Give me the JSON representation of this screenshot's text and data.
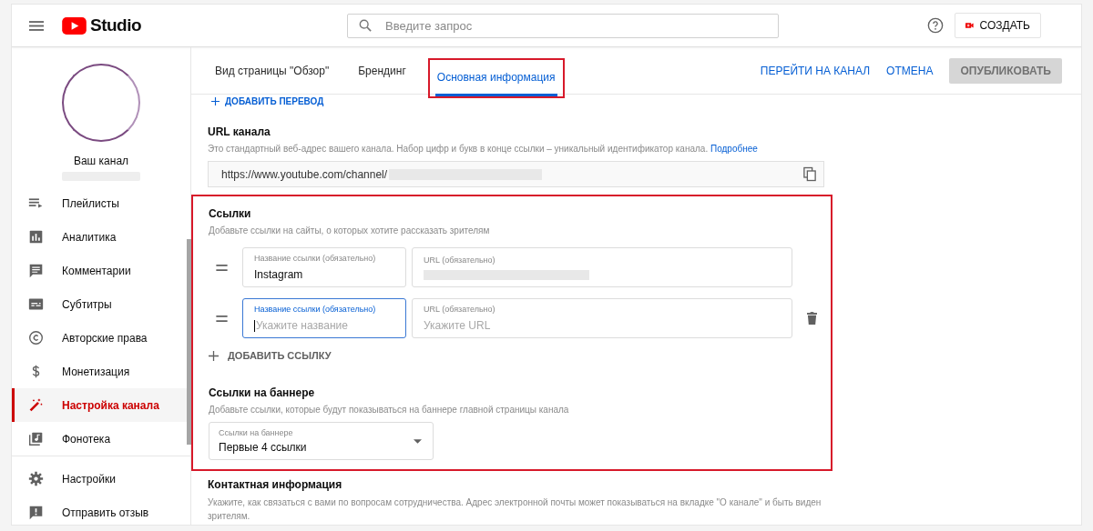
{
  "header": {
    "logo_text": "Studio",
    "search": {
      "placeholder": "Введите запрос"
    },
    "create_button": "СОЗДАТЬ"
  },
  "sidebar": {
    "channel_name": "Ваш канал",
    "items": [
      {
        "label": "Плейлисты",
        "selected": false
      },
      {
        "label": "Аналитика",
        "selected": false
      },
      {
        "label": "Комментарии",
        "selected": false
      },
      {
        "label": "Субтитры",
        "selected": false
      },
      {
        "label": "Авторские права",
        "selected": false
      },
      {
        "label": "Монетизация",
        "selected": false
      },
      {
        "label": "Настройка канала",
        "selected": true
      },
      {
        "label": "Фонотека",
        "selected": false
      }
    ],
    "footer_items": [
      {
        "label": "Настройки",
        "selected": false
      },
      {
        "label": "Отправить отзыв",
        "selected": false
      }
    ]
  },
  "tabs": [
    {
      "label": "Вид страницы \"Обзор\"",
      "selected": false,
      "annotated": false
    },
    {
      "label": "Брендинг",
      "selected": false,
      "annotated": false
    },
    {
      "label": "Основная информация",
      "selected": true,
      "annotated": true
    }
  ],
  "actions": {
    "view_channel": "ПЕРЕЙТИ НА КАНАЛ",
    "cancel": "ОТМЕНА",
    "publish": {
      "label": "ОПУБЛИКОВАТЬ",
      "disabled": true
    }
  },
  "add_translation": "ДОБАВИТЬ ПЕРЕВОД",
  "url_section": {
    "title": "URL канала",
    "description": "Это стандартный веб-адрес вашего канала. Набор цифр и букв в конце ссылки – уникальный идентификатор канала.",
    "link": "Подробнее",
    "value": "https://www.youtube.com/channel/"
  },
  "links_section": {
    "annotated": true,
    "title": "Ссылки",
    "description": "Добавьте ссылки на сайты, о которых хотите рассказать зрителям",
    "rows": [
      {
        "name_label": "Название ссылки (обязательно)",
        "name_value": "Instagram",
        "url_label": "URL (обязательно)",
        "url_redacted": true,
        "focused": false,
        "show_delete": false
      },
      {
        "name_label": "Название ссылки (обязательно)",
        "name_placeholder": "Укажите название",
        "url_label": "URL (обязательно)",
        "url_placeholder": "Укажите URL",
        "url_redacted": false,
        "focused": true,
        "show_delete": true
      }
    ],
    "add_link": "ДОБАВИТЬ ССЫЛКУ",
    "banner": {
      "title": "Ссылки на баннере",
      "description": "Добавьте ссылки, которые будут показываться на баннере главной страницы канала",
      "select_label": "Ссылки на баннере",
      "select_value": "Первые 4 ссылки"
    }
  },
  "contact_section": {
    "title": "Контактная информация",
    "description": "Укажите, как связаться с вами по вопросам сотрудничества. Адрес электронной почты может показываться на вкладке \"О канале\" и быть виден зрителям."
  }
}
